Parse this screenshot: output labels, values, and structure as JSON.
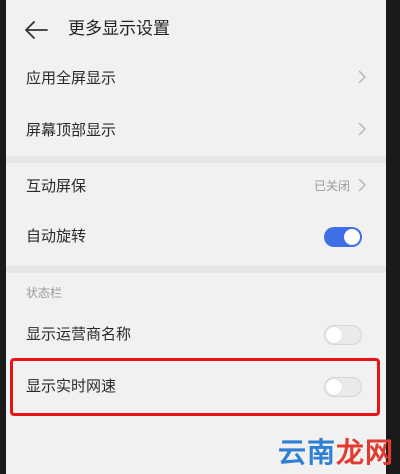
{
  "header": {
    "title": "更多显示设置",
    "back_icon": "arrow-left-icon"
  },
  "rows": [
    {
      "label": "应用全屏显示",
      "chevron_icon": "chevron-right-icon"
    },
    {
      "label": "屏幕顶部显示",
      "chevron_icon": "chevron-right-icon"
    },
    {
      "label": "互动屏保",
      "value": "已关闭",
      "chevron_icon": "chevron-right-icon"
    },
    {
      "label": "自动旋转",
      "toggle": true
    }
  ],
  "status_bar_section": {
    "label": "状态栏",
    "rows": [
      {
        "label": "显示运营商名称",
        "toggle": false
      },
      {
        "label": "显示实时网速",
        "toggle": false
      }
    ]
  },
  "highlight": {
    "color": "#e8141a"
  },
  "watermark": {
    "part1": "云南",
    "part2": "龙网",
    "color1": "#2f7fd4",
    "color2": "#e33a2f"
  },
  "colors": {
    "accent": "#3f6fe4",
    "background": "#f1f1f1"
  }
}
